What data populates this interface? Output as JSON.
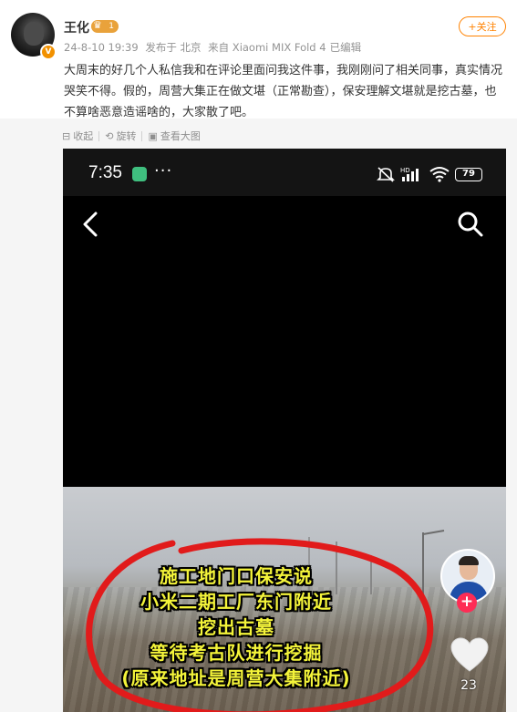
{
  "post": {
    "username": "王化",
    "level": "1",
    "verified_badge": "V",
    "meta": {
      "datetime": "24-8-10 19:39",
      "published_at": "发布于 北京",
      "device": "来自 Xiaomi MIX Fold 4",
      "edited": "已编辑"
    },
    "follow_label": "+关注",
    "text": "大周末的好几个人私信我和在评论里面问我这件事，我刚刚问了相关同事，真实情况哭笑不得。假的，周营大集正在做文堪（正常勘查），保安理解文堪就是挖古墓，也不算啥恶意造谣啥的，大家散了吧。"
  },
  "actions": {
    "collect": "收起",
    "rotate": "旋转",
    "view_large": "查看大图"
  },
  "screenshot": {
    "status_time": "7:35",
    "battery": "79",
    "caption_lines": [
      "施工地门口保安说",
      "小米二期工厂东门附近",
      "挖出古墓",
      "等待考古队进行挖掘",
      "(原来地址是周营大集附近)"
    ],
    "like_count": "23"
  },
  "colors": {
    "accent_orange": "#ff8200",
    "caption_yellow": "#f4f43a",
    "circle_red": "#e11b1b",
    "follow_pink": "#fe2c55"
  }
}
